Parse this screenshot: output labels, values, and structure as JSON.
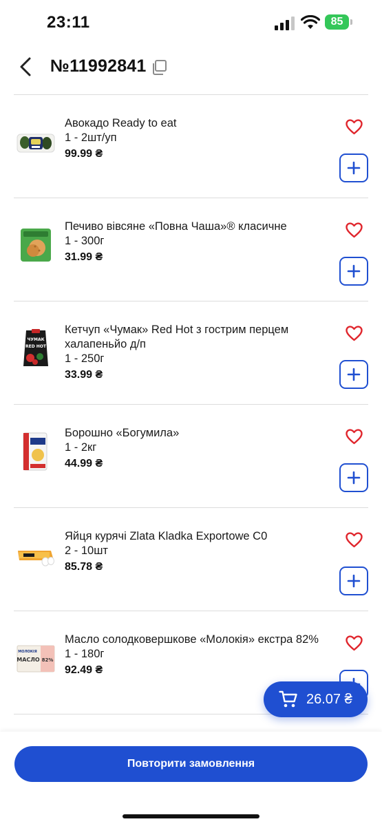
{
  "status_bar": {
    "time": "23:11",
    "battery": "85"
  },
  "header": {
    "order_number": "№11992841"
  },
  "products": [
    {
      "name": "Авокадо Ready to eat",
      "qty": "1 - 2шт/уп",
      "price": "99.99 ₴",
      "thumb": "avocado-pack"
    },
    {
      "name": "Печиво вівсяне «Повна Чаша»® класичне",
      "qty": "1 - 300г",
      "price": "31.99 ₴",
      "thumb": "cookie-pack"
    },
    {
      "name": "Кетчуп «Чумак» Red Hot з гострим перцем халапеньйо д/п",
      "qty": "1 - 250г",
      "price": "33.99 ₴",
      "thumb": "ketchup-pack"
    },
    {
      "name": "Борошно «Богумила»",
      "qty": "1 - 2кг",
      "price": "44.99 ₴",
      "thumb": "flour-pack"
    },
    {
      "name": "Яйця курячі Zlata Kladka Exportowe C0",
      "qty": "2 - 10шт",
      "price": "85.78 ₴",
      "thumb": "egg-carton"
    },
    {
      "name": "Масло солодковершкове «Молокія» екстра 82%",
      "qty": "1 - 180г",
      "price": "92.49 ₴",
      "thumb": "butter-pack"
    }
  ],
  "thumb_text": {
    "butter_brand": "МОЛОКІЯ",
    "butter_label": "МАСЛО",
    "butter_percent": "82%",
    "ketchup_brand": "ЧУМАК",
    "ketchup_text": "RED HOT"
  },
  "cart": {
    "total": "26.07 ₴"
  },
  "footer": {
    "repeat_label": "Повторити замовлення"
  },
  "colors": {
    "accent": "#1f4fd1",
    "heart": "#e0262d",
    "divider": "#dcdcdc",
    "battery": "#34c759"
  }
}
